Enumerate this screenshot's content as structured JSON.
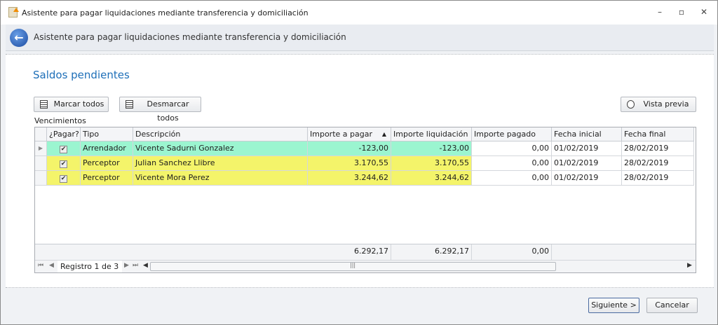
{
  "window": {
    "title": "Asistente para pagar liquidaciones mediante transferencia y domiciliación",
    "controls": [
      "minimize",
      "restore",
      "close"
    ]
  },
  "header": {
    "title": "Asistente para pagar liquidaciones mediante transferencia y domiciliación"
  },
  "section_title": "Saldos pendientes",
  "toolbar": {
    "mark_all": "Marcar todos",
    "unmark_all": "Desmarcar todos",
    "preview": "Vista previa"
  },
  "grid": {
    "label": "Vencimientos",
    "columns": [
      "¿Pagar?",
      "Tipo",
      "Descripción",
      "Importe a pagar",
      "Importe liquidación",
      "Importe pagado",
      "Fecha inicial",
      "Fecha final"
    ],
    "rows": [
      {
        "pagar": "✔",
        "tipo": "Arrendador",
        "descripcion": "Vicente Sadurni Gonzalez",
        "importe": "-123,00",
        "liquidacion": "-123,00",
        "pagado": "0,00",
        "inicio": "01/02/2019",
        "fin": "28/02/2019",
        "color": "#9bf5d0"
      },
      {
        "pagar": "✔",
        "tipo": "Perceptor",
        "descripcion": "Julian Sanchez Llibre",
        "importe": "3.170,55",
        "liquidacion": "3.170,55",
        "pagado": "0,00",
        "inicio": "01/02/2019",
        "fin": "28/02/2019",
        "color": "#f4f46a"
      },
      {
        "pagar": "✔",
        "tipo": "Perceptor",
        "descripcion": "Vicente Mora Perez",
        "importe": "3.244,62",
        "liquidacion": "3.244,62",
        "pagado": "0,00",
        "inicio": "01/02/2019",
        "fin": "28/02/2019",
        "color": "#f4f46a"
      }
    ],
    "totals": {
      "importe": "6.292,17",
      "liquidacion": "6.292,17",
      "pagado": "0,00"
    },
    "record": "Registro 1 de 3"
  },
  "footer": {
    "next": "Siguiente >",
    "cancel": "Cancelar"
  }
}
